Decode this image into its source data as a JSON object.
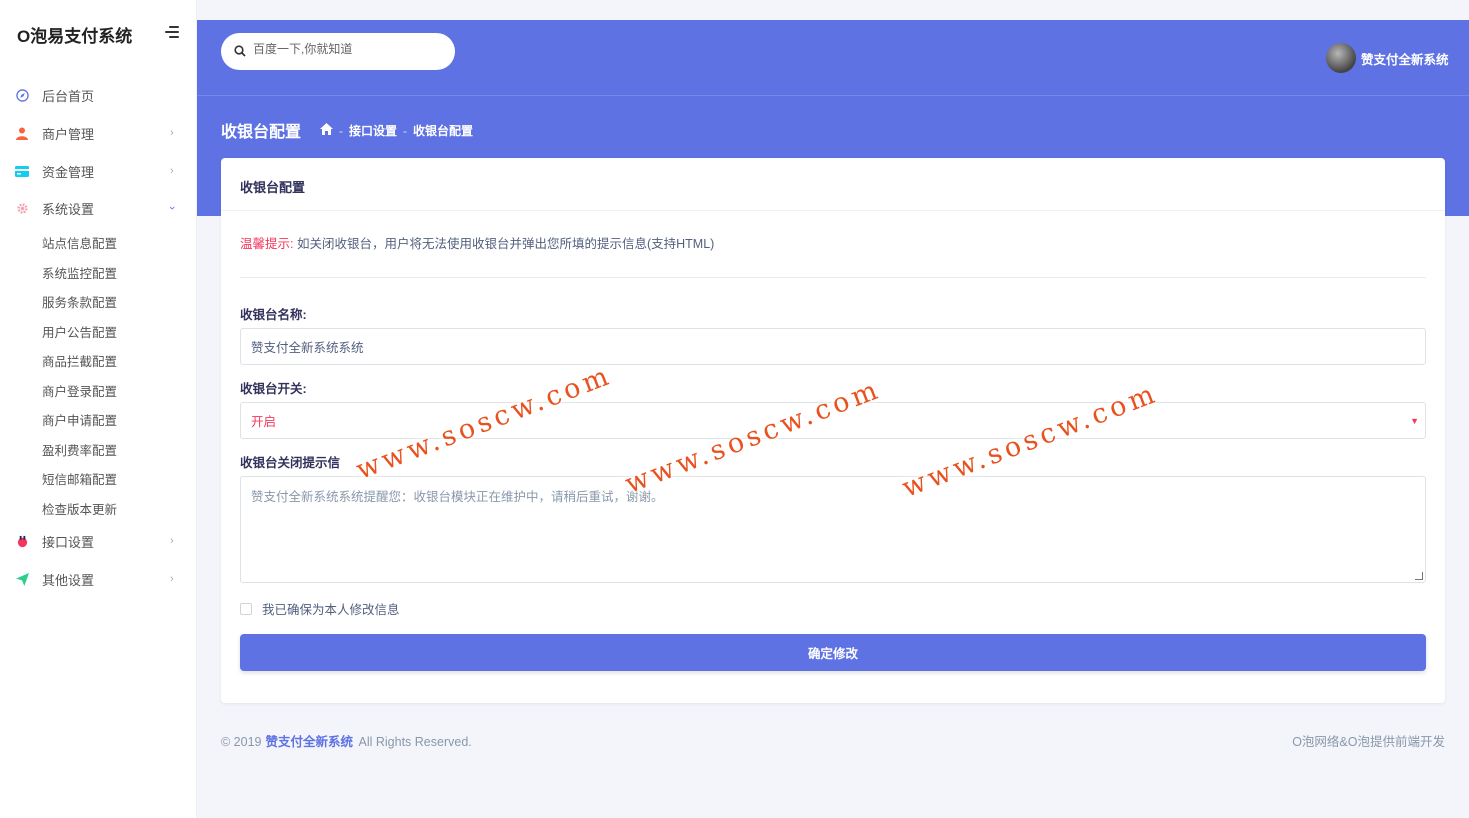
{
  "sidebar": {
    "brand": "O泡易支付系统",
    "items": [
      {
        "label": "后台首页",
        "icon": "compass-icon"
      },
      {
        "label": "商户管理",
        "icon": "user-icon"
      },
      {
        "label": "资金管理",
        "icon": "card-icon"
      },
      {
        "label": "系统设置",
        "icon": "gear-icon"
      },
      {
        "label": "接口设置",
        "icon": "plug-icon"
      },
      {
        "label": "其他设置",
        "icon": "send-icon"
      }
    ],
    "sub_items": [
      "站点信息配置",
      "系统监控配置",
      "服务条款配置",
      "用户公告配置",
      "商品拦截配置",
      "商户登录配置",
      "商户申请配置",
      "盈利费率配置",
      "短信邮箱配置",
      "检查版本更新"
    ]
  },
  "header": {
    "search_placeholder": "百度一下,你就知道",
    "username": "赞支付全新系统",
    "page_title": "收银台配置",
    "breadcrumb": [
      "接口设置",
      "收银台配置"
    ]
  },
  "card": {
    "title": "收银台配置",
    "tip_label": "温馨提示:",
    "tip_text": "如关闭收银台，用户将无法使用收银台并弹出您所填的提示信息(支持HTML)",
    "name_label": "收银台名称:",
    "name_value": "赞支付全新系统系统",
    "switch_label": "收银台开关:",
    "switch_value": "开启",
    "close_tip_label": "收银台关闭提示信",
    "close_tip_value": "赞支付全新系统系统提醒您：收银台模块正在维护中，请稍后重试，谢谢。",
    "confirm_label": "我已确保为本人修改信息",
    "submit_label": "确定修改"
  },
  "footer": {
    "copyright": "© 2019",
    "brand": "赞支付全新系统",
    "rights": "All Rights Reserved.",
    "credit": "O泡网络&O泡提供前端开发"
  },
  "watermark": [
    "www.soscw.com",
    "www.soscw.com",
    "www.soscw.com"
  ],
  "colors": {
    "accent": "#5e72e4",
    "danger": "#f5365c",
    "watermark": "#e8521e"
  }
}
